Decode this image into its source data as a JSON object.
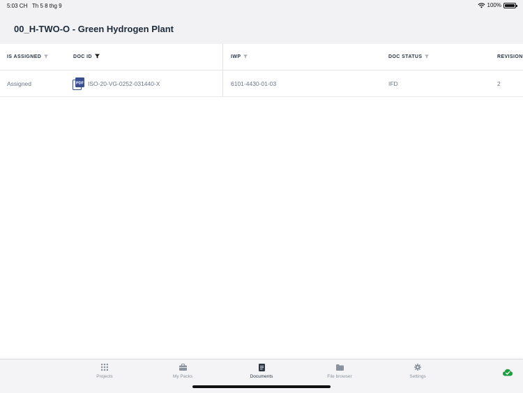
{
  "status_bar": {
    "time": "5:03 CH",
    "date": "Th 5 8 thg 9",
    "battery_percent": "100%",
    "battery_level": 1.0
  },
  "page": {
    "title": "00_H-TWO-O - Green Hydrogen Plant"
  },
  "table": {
    "columns": [
      {
        "label": "IS ASSIGNED",
        "filter_active": false
      },
      {
        "label": "DOC ID",
        "filter_active": true
      },
      {
        "label": "IWP",
        "filter_active": false
      },
      {
        "label": "DOC STATUS",
        "filter_active": false
      },
      {
        "label": "REVISION",
        "filter_active": false
      }
    ],
    "rows": [
      {
        "is_assigned": "Assigned",
        "doc_id": "ISO-20-VG-0252-031440-X",
        "file_icon": "pdf-file-icon",
        "pdf_badge": "PDF",
        "iwp": "6101-4430-01-03",
        "doc_status": "IFD",
        "revision": "2"
      }
    ]
  },
  "tabs": [
    {
      "label": "Projects",
      "icon": "grid-icon",
      "active": false
    },
    {
      "label": "My Packs",
      "icon": "briefcase-icon",
      "active": false
    },
    {
      "label": "Documents",
      "icon": "document-icon",
      "active": true
    },
    {
      "label": "File browser",
      "icon": "folder-icon",
      "active": false
    },
    {
      "label": "Settings",
      "icon": "gear-icon",
      "active": false
    }
  ],
  "sync": {
    "icon": "cloud-check-icon",
    "color": "#1e9e3e"
  },
  "colors": {
    "accent": "#3a4f8f",
    "text_dark": "#1d2a3a",
    "text_muted": "#6b7684"
  }
}
